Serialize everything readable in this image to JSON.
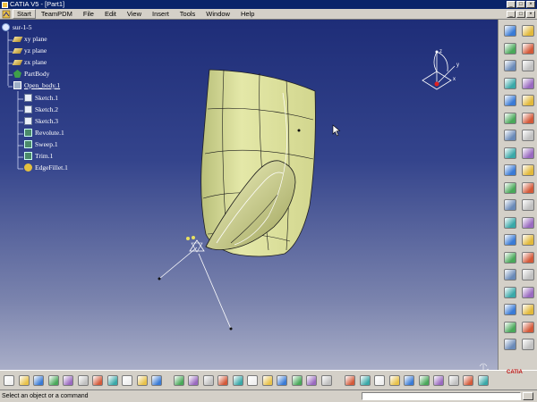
{
  "window": {
    "title": "CATIA V5 - [Part1]",
    "controls": [
      "minimize",
      "maximize",
      "close"
    ]
  },
  "menu": {
    "items": [
      "Start",
      "TeamPDM",
      "File",
      "Edit",
      "View",
      "Insert",
      "Tools",
      "Window",
      "Help"
    ]
  },
  "tree": {
    "root": "sur-1-5",
    "nodes": [
      {
        "label": "xy plane",
        "icon": "plane-icon"
      },
      {
        "label": "yz plane",
        "icon": "plane-icon"
      },
      {
        "label": "zx plane",
        "icon": "plane-icon"
      },
      {
        "label": "PartBody",
        "icon": "partbody-icon"
      },
      {
        "label": "Open_body.1",
        "icon": "open-body-icon"
      },
      {
        "label": "Sketch.1",
        "icon": "sketch-icon"
      },
      {
        "label": "Sketch.2",
        "icon": "sketch-icon"
      },
      {
        "label": "Sketch.3",
        "icon": "sketch-icon"
      },
      {
        "label": "Revolute.1",
        "icon": "revolute-icon"
      },
      {
        "label": "Sweep.1",
        "icon": "sweep-icon"
      },
      {
        "label": "Trim.1",
        "icon": "trim-icon"
      },
      {
        "label": "EdgeFillet.1",
        "icon": "edge-fillet-icon"
      }
    ]
  },
  "compass": {
    "axis_z": "z",
    "axis_y": "y",
    "axis_x": "x"
  },
  "right_toolbar": {
    "buttons": [
      "sketch-icon",
      "select-arrow-icon",
      "extrude-icon",
      "no-update-icon",
      "revolve-icon",
      "sphere-icon",
      "sweep-icon",
      "fill-icon",
      "offset-icon",
      "blend-icon",
      "join-icon",
      "heal-icon",
      "split-icon",
      "trim-icon",
      "boundary-icon",
      "extract-icon",
      "shape-fillet-icon",
      "edge-fillet-icon",
      "translate-icon",
      "rotate-icon",
      "point-icon",
      "line-icon",
      "plane-icon",
      "projection-icon",
      "intersection-icon",
      "corner-icon",
      "parallel-curve-icon",
      "circle-icon",
      "spline-icon",
      "helix-icon",
      "analysis-icon",
      "measure-icon",
      "constraint-icon",
      "formula-icon",
      "law-icon",
      "catalog-icon",
      "instantiate-icon",
      "draft-analysis-icon"
    ]
  },
  "bottom_toolbar": {
    "buttons": [
      "new-icon",
      "open-icon",
      "save-icon",
      "save-all-icon",
      "print-icon",
      "cut-icon",
      "copy-icon",
      "paste-icon",
      "undo-icon",
      "redo-icon",
      "whats-this-icon",
      "tools-palette-icon",
      "fit-all-icon",
      "pan-icon",
      "rotate-view-icon",
      "zoom-in-icon",
      "zoom-out-icon",
      "normal-view-icon",
      "iso-view-icon",
      "render-style-icon",
      "hide-show-icon",
      "swap-space-icon",
      "update-icon",
      "parameters-icon",
      "graph-tree-icon",
      "formula-icon",
      "design-table-icon",
      "grid-icon",
      "snap-icon",
      "axis-icon",
      "measure-icon",
      "catia-logo-icon"
    ]
  },
  "status": {
    "message": "Select an object or a command",
    "command_input": ""
  },
  "logo": {
    "text": "CATIA"
  }
}
